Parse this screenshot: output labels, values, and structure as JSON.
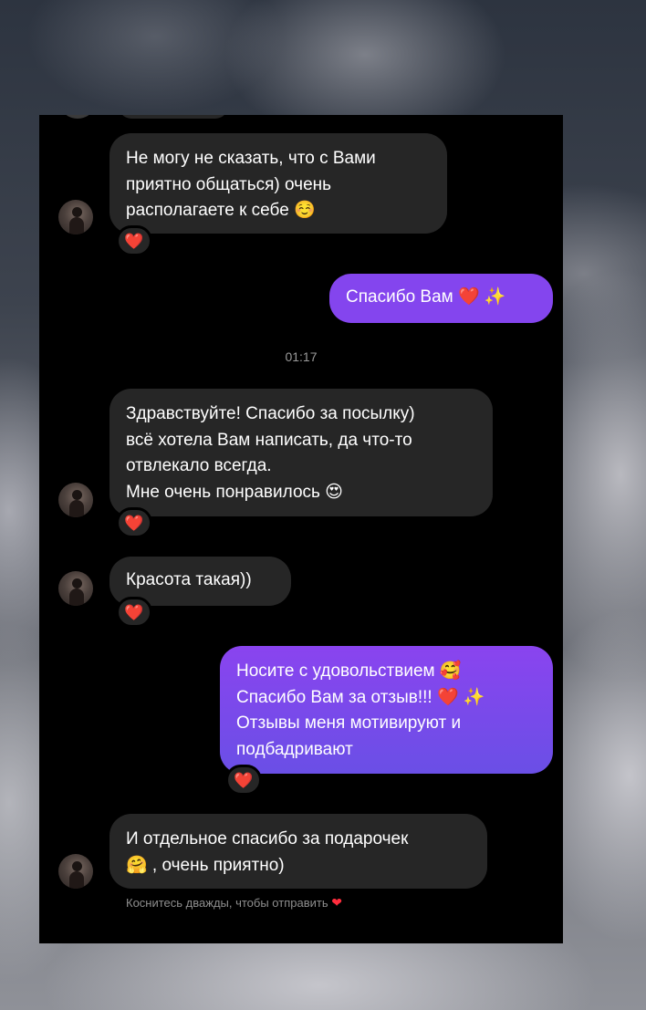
{
  "colors": {
    "chat_background": "#000000",
    "incoming_bubble": "#262626",
    "outgoing_bubble_start": "#8a44ef",
    "outgoing_bubble_end": "#6a4fe6",
    "reaction_heart": "#ff2d3d",
    "timestamp_text": "#9a9a9a"
  },
  "messages": {
    "m1": {
      "text": "Не могу не сказать, что с Вами\nприятно общаться) очень\nрасполагаете к себе ☺️",
      "reaction": "❤️"
    },
    "m2": {
      "text": "Спасибо Вам ❤️ ✨"
    },
    "timestamp": "01:17",
    "m3": {
      "text": "Здравствуйте! Спасибо за посылку)\nвсё хотела Вам написать, да что-то\nотвлекало всегда.\nМне очень понравилось 😍",
      "reaction": "❤️"
    },
    "m4": {
      "text": "Красота такая))",
      "reaction": "❤️"
    },
    "m5": {
      "text": "Носите с удовольствием 🥰\nСпасибо Вам за отзыв!!! ❤️ ✨\nОтзывы меня мотивируют и\nподбадривают",
      "reaction": "❤️"
    },
    "m6": {
      "text": "И отдельное спасибо за подарочек\n🤗 , очень приятно)"
    }
  },
  "hint": {
    "text": "Коснитесь дважды, чтобы отправить",
    "icon": "heart-icon",
    "icon_glyph": "❤"
  },
  "icons": {
    "avatar": "profile-photo",
    "reaction": "heart-reaction"
  }
}
